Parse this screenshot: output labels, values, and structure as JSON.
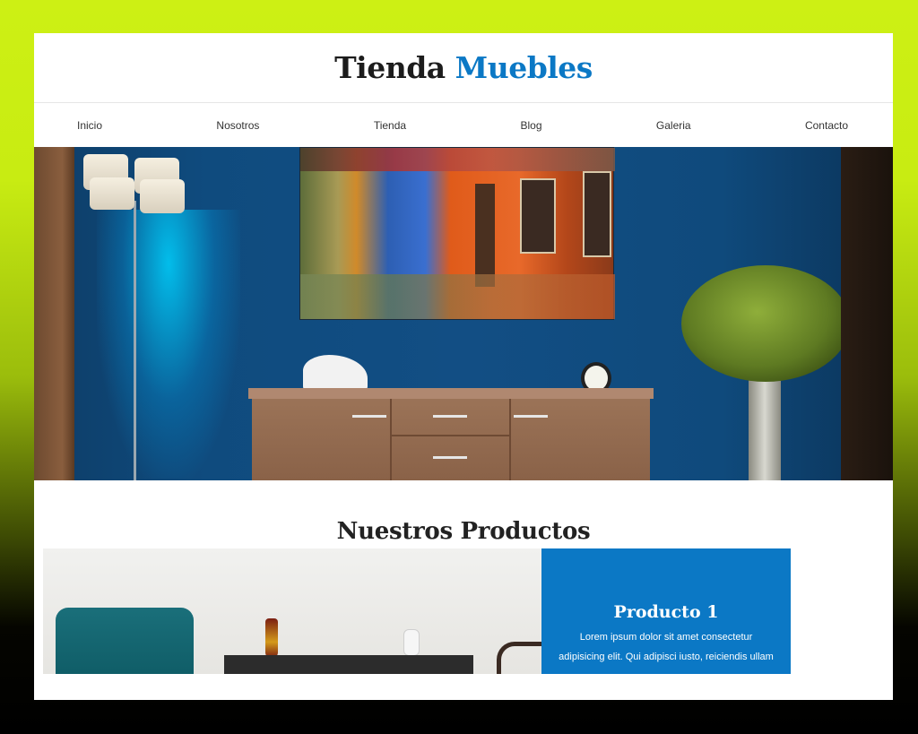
{
  "header": {
    "logo_part1": "Tienda",
    "logo_part2": "Muebles"
  },
  "nav": {
    "items": [
      {
        "label": "Inicio"
      },
      {
        "label": "Nosotros"
      },
      {
        "label": "Tienda"
      },
      {
        "label": "Blog"
      },
      {
        "label": "Galeria"
      },
      {
        "label": "Contacto"
      }
    ]
  },
  "main": {
    "section_title": "Nuestros Productos",
    "products": [
      {
        "title": "Producto 1",
        "description": "Lorem ipsum dolor sit amet consectetur adipisicing elit. Qui adipisci iusto, reiciendis ullam"
      }
    ]
  },
  "colors": {
    "accent": "#0b78c5",
    "frame_top": "#cdf014",
    "frame_bottom": "#000000"
  }
}
